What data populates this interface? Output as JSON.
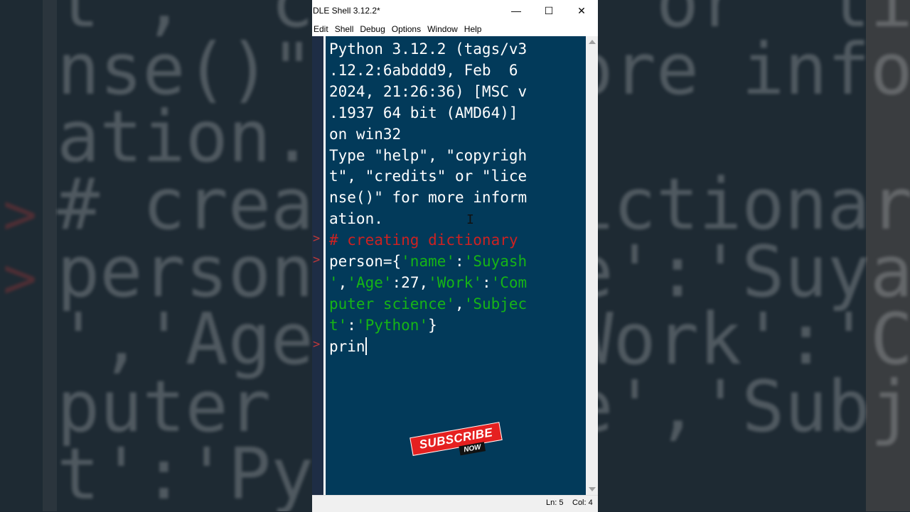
{
  "window": {
    "title": "DLE Shell 3.12.2*",
    "controls": {
      "minimize": "—",
      "maximize": "☐",
      "close": "✕"
    }
  },
  "menu": [
    "Edit",
    "Shell",
    "Debug",
    "Options",
    "Window",
    "Help"
  ],
  "shell": {
    "banner": [
      "Python 3.12.2 (tags/v3",
      ".12.2:6abddd9, Feb  6",
      "2024, 21:26:36) [MSC v",
      ".1937 64 bit (AMD64)]",
      "on win32",
      "Type \"help\", \"copyrigh",
      "t\", \"credits\" or \"lice",
      "nse()\" for more inform",
      "ation."
    ],
    "comment_line": "# creating dictionary",
    "code_line1_a": "person={",
    "code_line1_b": "'name'",
    "code_line1_c": ":",
    "code_line1_d": "'Suyash",
    "code_line2_a": "'",
    "code_line2_b": ",",
    "code_line2_c": "'Age'",
    "code_line2_d": ":27,",
    "code_line2_e": "'Work'",
    "code_line2_f": ":",
    "code_line2_g": "'Com",
    "code_line3_a": "puter science'",
    "code_line3_b": ",",
    "code_line3_c": "'Subjec",
    "code_line4_a": "t'",
    "code_line4_b": ":",
    "code_line4_c": "'Python'",
    "code_line4_d": "}",
    "input_line": "prin",
    "prompt_symbol": ">"
  },
  "status": {
    "line": "Ln: 5",
    "col": "Col: 4"
  },
  "badge": {
    "main": "SUBSCRIBE",
    "sub": "NOW"
  },
  "background": {
    "text": "t\", \"credits\" or \"lice\nnse()\" for more inform\nation.\n# creating dictionary\nperson={'name':'Suyash\n','Age':27,'Work':'Com\nputer science','Subjec\nt':'Python'}"
  },
  "colors": {
    "code_bg": "#023a5a",
    "comment": "#cc2222",
    "string": "#16b416",
    "gutter": "#1e2d45",
    "badge": "#e52020"
  }
}
